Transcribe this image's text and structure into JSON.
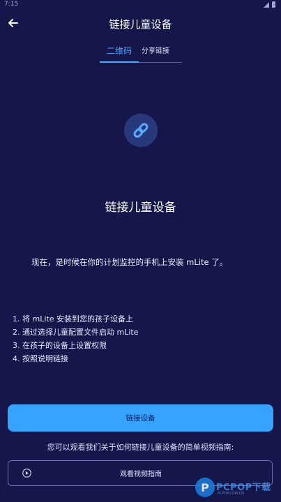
{
  "statusbar": {
    "time": "7:15"
  },
  "header": {
    "title": "链接儿童设备"
  },
  "tabs": [
    {
      "label": "二维码",
      "active": true
    },
    {
      "label": "分享链接",
      "active": false
    }
  ],
  "main": {
    "icon": "link-icon",
    "title": "链接儿童设备",
    "intro": "现在，是时候在你的计划监控的手机上安装 mLite 了。",
    "steps": [
      "1. 将 mLite 安装到您的孩子设备上",
      "2. 通过选择儿童配置文件启动 mLite",
      "3. 在孩子的设备上设置权限",
      "4. 按照说明链接"
    ]
  },
  "actions": {
    "link_button": "链接设备",
    "video_hint": "您可以观看我们关于如何链接儿童设备的简单视频指南:",
    "video_button": "观看视频指南"
  },
  "watermark": {
    "badge": "P",
    "text": "PCPOP下载",
    "sub": "PCPOP.COM.CN"
  },
  "colors": {
    "background": "#15164a",
    "accent": "#35a3ff",
    "tab_active": "#4aa8ff",
    "icon_circle": "#27397a"
  }
}
